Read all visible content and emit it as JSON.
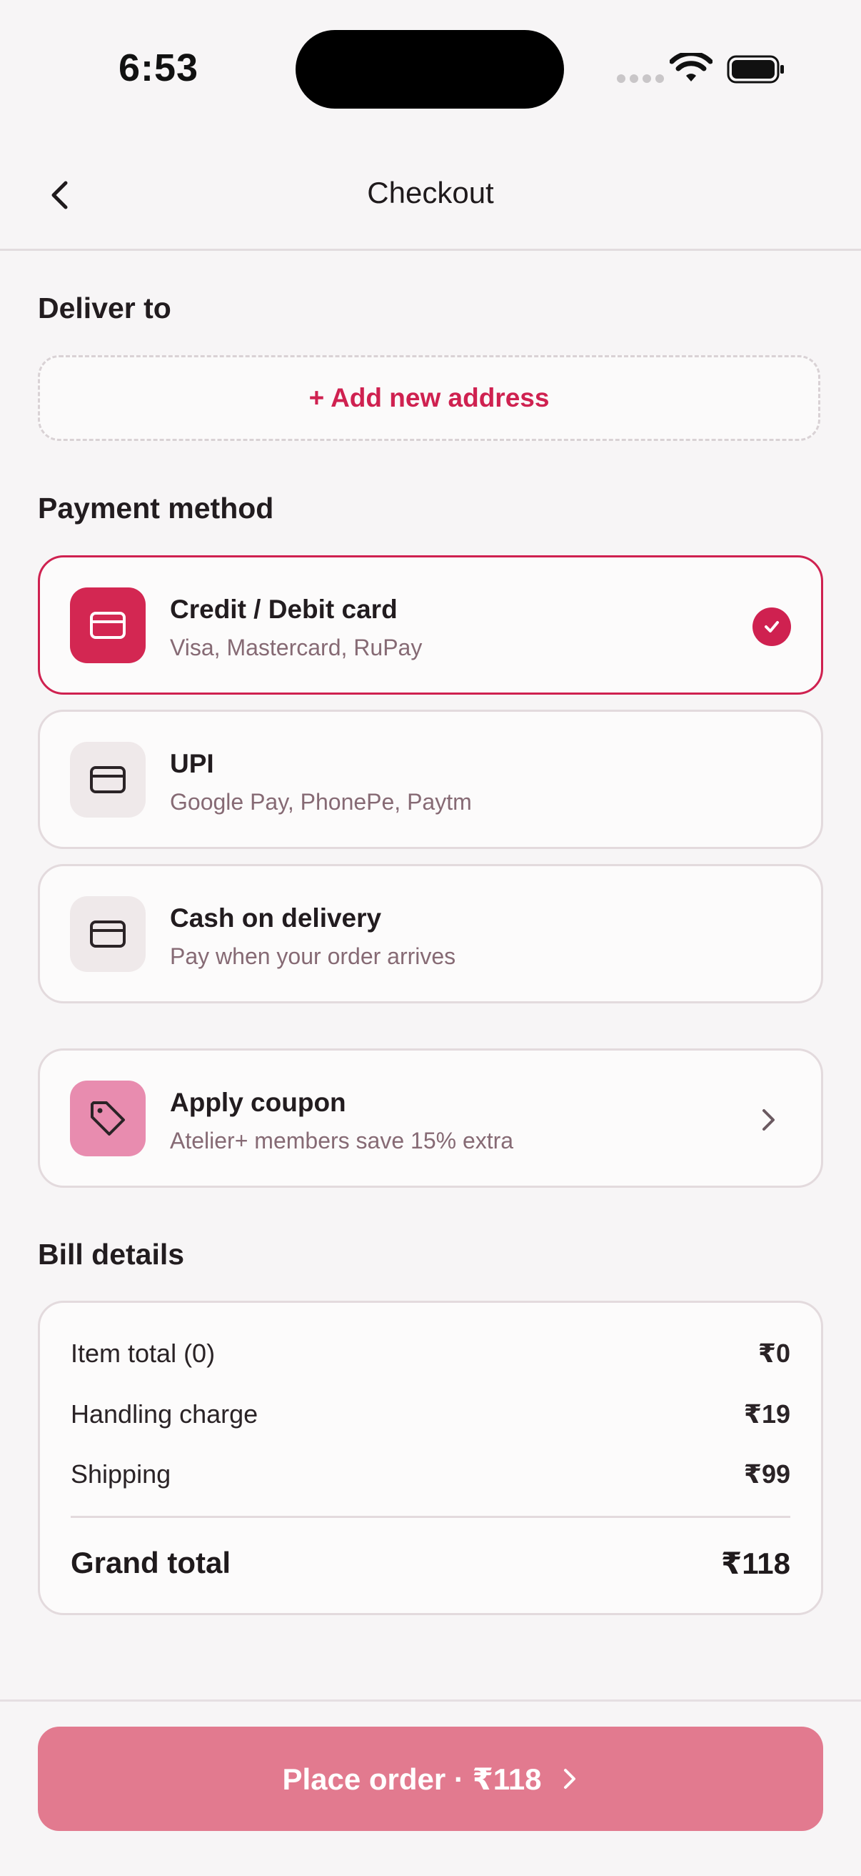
{
  "status": {
    "time": "6:53"
  },
  "nav": {
    "title": "Checkout"
  },
  "deliver": {
    "title": "Deliver to",
    "add_address": "+ Add new address"
  },
  "payment": {
    "title": "Payment method",
    "options": [
      {
        "title": "Credit / Debit card",
        "subtitle": "Visa, Mastercard, RuPay",
        "selected": true,
        "icon": "credit-card-icon"
      },
      {
        "title": "UPI",
        "subtitle": "Google Pay, PhonePe, Paytm",
        "selected": false,
        "icon": "credit-card-icon"
      },
      {
        "title": "Cash on delivery",
        "subtitle": "Pay when your order arrives",
        "selected": false,
        "icon": "credit-card-icon"
      }
    ]
  },
  "coupon": {
    "title": "Apply coupon",
    "subtitle": "Atelier+ members save 15% extra",
    "icon": "tag-icon"
  },
  "bill": {
    "title": "Bill details",
    "rows": [
      {
        "label": "Item total (0)",
        "value": "₹0"
      },
      {
        "label": "Handling charge",
        "value": "₹19"
      },
      {
        "label": "Shipping",
        "value": "₹99"
      }
    ],
    "total_label": "Grand total",
    "total_value": "₹118"
  },
  "cta": {
    "label": "Place order · ₹118"
  },
  "colors": {
    "accent": "#cf2150",
    "cta": "#e27a8f"
  }
}
